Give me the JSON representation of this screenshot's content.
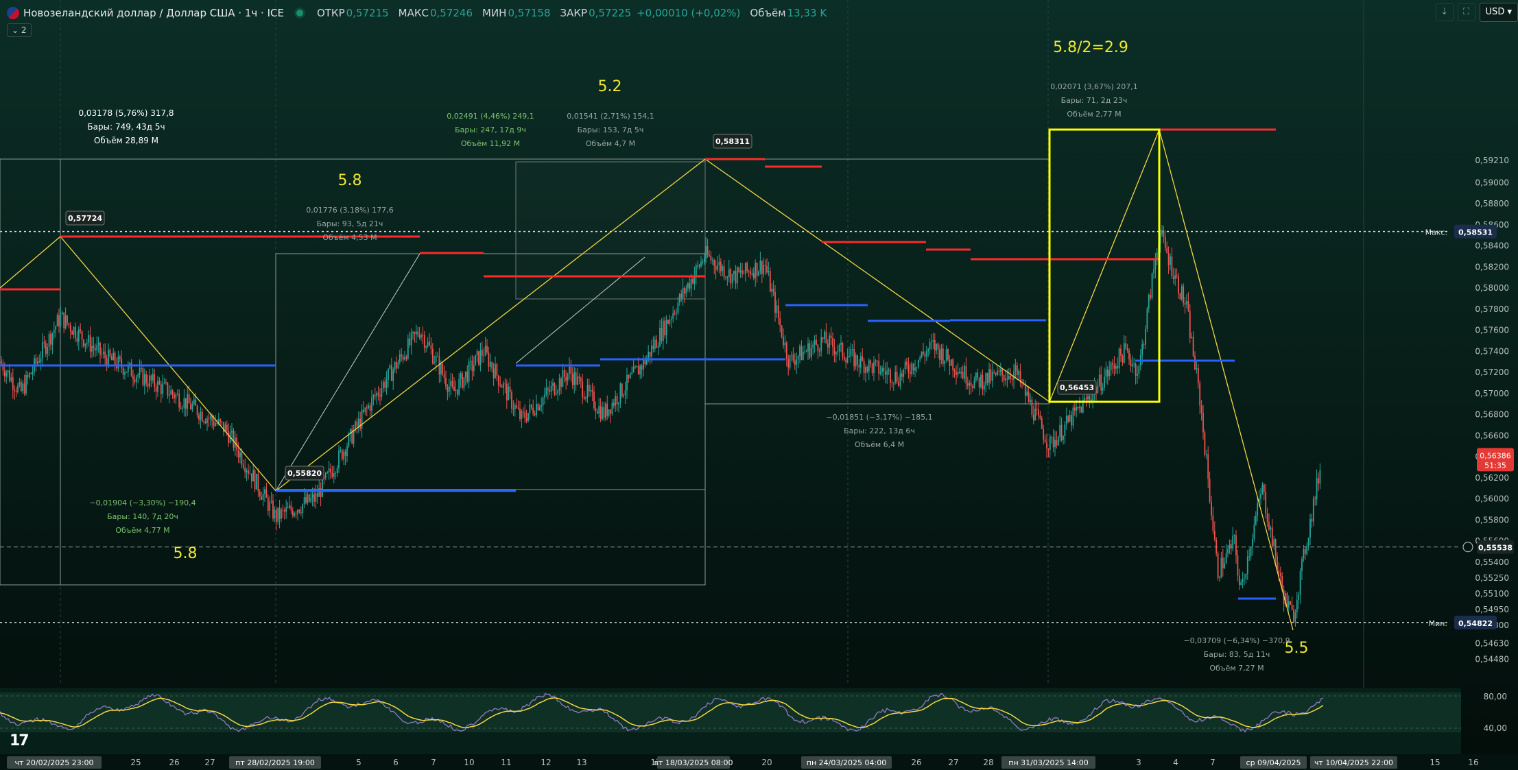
{
  "header": {
    "title": "Новозеландский доллар / Доллар США · 1ч · ICE",
    "open_label": "ОТКР",
    "open_value": "0,57215",
    "high_label": "МАКС",
    "high_value": "0,57246",
    "low_label": "МИН",
    "low_value": "0,57158",
    "close_label": "ЗАКР",
    "close_value": "0,57225",
    "change": "+0,00010 (+0,02%)",
    "volume_label": "Объём",
    "volume_value": "13,33 K",
    "indicator_count": "2",
    "currency": "USD"
  },
  "price_axis": {
    "ticks": [
      "0,59210",
      "0,59000",
      "0,58800",
      "0,58600",
      "0,58400",
      "0,58200",
      "0,58000",
      "0,57800",
      "0,57600",
      "0,57400",
      "0,57200",
      "0,57000",
      "0,56800",
      "0,56600",
      "0,56400",
      "0,56200",
      "0,56000",
      "0,55800",
      "0,55600",
      "0,55400",
      "0,55250",
      "0,55100",
      "0,54950",
      "0,54800",
      "0,54630",
      "0,54480"
    ],
    "max_label": "Макс.",
    "max_value": "0,58531",
    "min_label": "Мин.",
    "min_value": "0,54822",
    "last_price": "0,56386",
    "countdown": "51:35",
    "crosshair_price": "0,55538"
  },
  "rsi_axis": {
    "ticks": [
      "80,00",
      "40,00"
    ]
  },
  "time_axis": {
    "labels": [
      "25",
      "26",
      "27",
      "5",
      "6",
      "7",
      "10",
      "11",
      "12",
      "13",
      "17",
      "20",
      "26",
      "27",
      "28",
      "2",
      "3",
      "4",
      "7",
      "15",
      "16"
    ],
    "highlights": [
      "чт 20/02/2025   23:00",
      "пт 28/02/2025   19:00",
      "вт 18/03/2025   08:00",
      "пн 24/03/2025   04:00",
      "пн 31/03/2025   14:00",
      "ср 09/04/2025",
      "чт 10/04/2025   22:00"
    ]
  },
  "annotations": {
    "count_labels": [
      "5.8",
      "5.2",
      "5.8",
      "5.8/2=2.9",
      "5.5"
    ],
    "price_flags": [
      "0,57724",
      "0,55820",
      "0,58311",
      "0,56453"
    ],
    "measures": [
      {
        "line1": "0,03178 (5,76%) 317,8",
        "line2": "Бары: 749, 43д 5ч",
        "line3": "Объём 28,89 M"
      },
      {
        "line1": "0,02491 (4,46%) 249,1",
        "line2": "Бары: 247, 17д 9ч",
        "line3": "Объём 11,92 M"
      },
      {
        "line1": "0,01541 (2,71%) 154,1",
        "line2": "Бары: 153, 7д 5ч",
        "line3": "Объём 4,7 M"
      },
      {
        "line1": "0,01776 (3,18%) 177,6",
        "line2": "Бары: 93, 5д 21ч",
        "line3": "Объём 4,53 M"
      },
      {
        "line1": "−0,01904 (−3,30%) −190,4",
        "line2": "Бары: 140, 7д 20ч",
        "line3": "Объём 4,77 M"
      },
      {
        "line1": "−0,01851 (−3,17%) −185,1",
        "line2": "Бары: 222, 13д 6ч",
        "line3": "Объём 6,4 M"
      },
      {
        "line1": "0,02071 (3,67%) 207,1",
        "line2": "Бары: 71, 2д 23ч",
        "line3": "Объём 2,77 M"
      },
      {
        "line1": "−0,03709 (−6,34%) −370,9",
        "line2": "Бары: 83, 5д 11ч",
        "line3": "Объём 7,27 M"
      }
    ]
  },
  "colors": {
    "background": "#041712",
    "up": "#26a69a",
    "down": "#ef5350",
    "resistance": "#ff2a2a",
    "support": "#2962ff",
    "trend": "#f5d742",
    "box": "#ffff00",
    "rsi": "#8e7cc3",
    "rsi_ma": "#f5d742"
  },
  "icons": [
    "nzd-usd-flag-icon",
    "live-status-icon",
    "download-icon",
    "fullscreen-icon",
    "tradingview-logo-icon"
  ]
}
